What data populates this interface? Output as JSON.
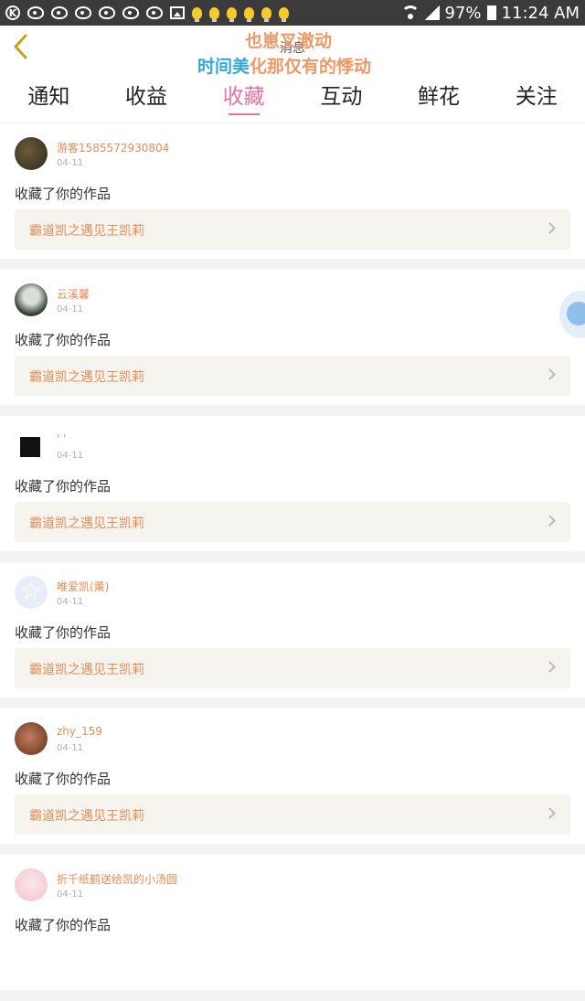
{
  "status_bar": {
    "battery": "97%",
    "time": "11:24 AM",
    "icons": [
      "k-icon",
      "weibo-icon",
      "weibo-icon",
      "weibo-icon",
      "weibo-icon",
      "weibo-icon",
      "weibo-icon",
      "image-icon",
      "bulb-icon",
      "bulb-icon",
      "bulb-icon",
      "bulb-icon",
      "bulb-icon",
      "bulb-icon",
      "wifi-icon",
      "signal-icon",
      "battery-icon"
    ]
  },
  "header": {
    "title": "消息",
    "overlay_line1": "也崽叉澈动",
    "overlay_line2_blue": "时间美",
    "overlay_line2_orange": "化那仅有的悸动"
  },
  "tabs": [
    "通知",
    "收益",
    "收藏",
    "互动",
    "鲜花",
    "关注"
  ],
  "active_tab": 2,
  "colors": {
    "accent_pink": "#e9709f",
    "name_orange": "#e88c55",
    "work_bg": "#f5f4ee"
  },
  "items": [
    {
      "username": "游客1585572930804",
      "date": "04-11",
      "action": "收藏了你的作品",
      "work": "霸道凯之遇见王凯莉"
    },
    {
      "username": "云溪馨",
      "date": "04-11",
      "action": "收藏了你的作品",
      "work": "霸道凯之遇见王凯莉"
    },
    {
      "username": "' '",
      "date": "04-11",
      "action": "收藏了你的作品",
      "work": "霸道凯之遇见王凯莉"
    },
    {
      "username": "唯爱凯(薰)",
      "date": "04-11",
      "action": "收藏了你的作品",
      "work": "霸道凯之遇见王凯莉"
    },
    {
      "username": "zhy_159",
      "date": "04-11",
      "action": "收藏了你的作品",
      "work": "霸道凯之遇见王凯莉"
    },
    {
      "username": "折千纸鹤送给凯的小汤圆",
      "date": "04-11",
      "action": "收藏了你的作品",
      "work": ""
    }
  ]
}
